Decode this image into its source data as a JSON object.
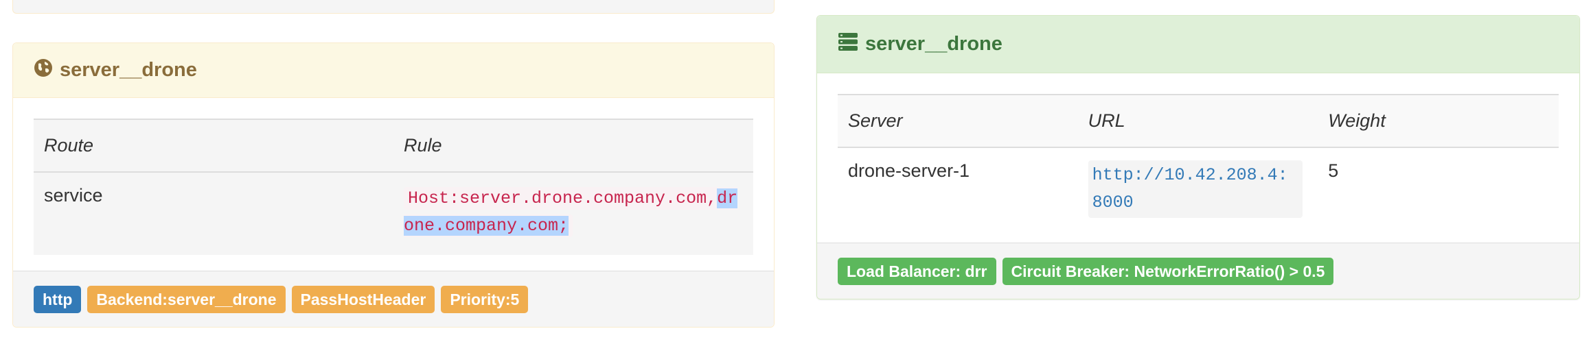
{
  "colors": {
    "primary": "#337ab7",
    "warning": "#f0ad4e",
    "success": "#5cb85c",
    "frontend_heading_text": "#8a6d3b",
    "backend_heading_text": "#3c763d",
    "rule_code": "#c7254e",
    "selection": "#b4d5fe"
  },
  "previous_panel": {
    "badge_colors": [
      "#337ab7",
      "#f0ad4e",
      "#f0ad4e",
      "#f0ad4e"
    ]
  },
  "frontend": {
    "icon": "globe-icon",
    "title": "server__drone",
    "columns": {
      "route": "Route",
      "rule": "Rule"
    },
    "rows": [
      {
        "route": "service",
        "rule_unselected": "Host:server.drone.company.com,",
        "rule_selected": "drone.company.com;"
      }
    ],
    "badges": {
      "entrypoint": "http",
      "backend": "Backend:server__drone",
      "pass_host_header": "PassHostHeader",
      "priority": "Priority:5"
    }
  },
  "backend": {
    "icon": "server-icon",
    "title": "server__drone",
    "columns": {
      "server": "Server",
      "url": "URL",
      "weight": "Weight"
    },
    "rows": [
      {
        "server": "drone-server-1",
        "url": "http://10.42.208.4:8000",
        "weight": "5"
      }
    ],
    "badges": {
      "load_balancer": "Load Balancer: drr",
      "circuit_breaker": "Circuit Breaker: NetworkErrorRatio() > 0.5"
    }
  }
}
